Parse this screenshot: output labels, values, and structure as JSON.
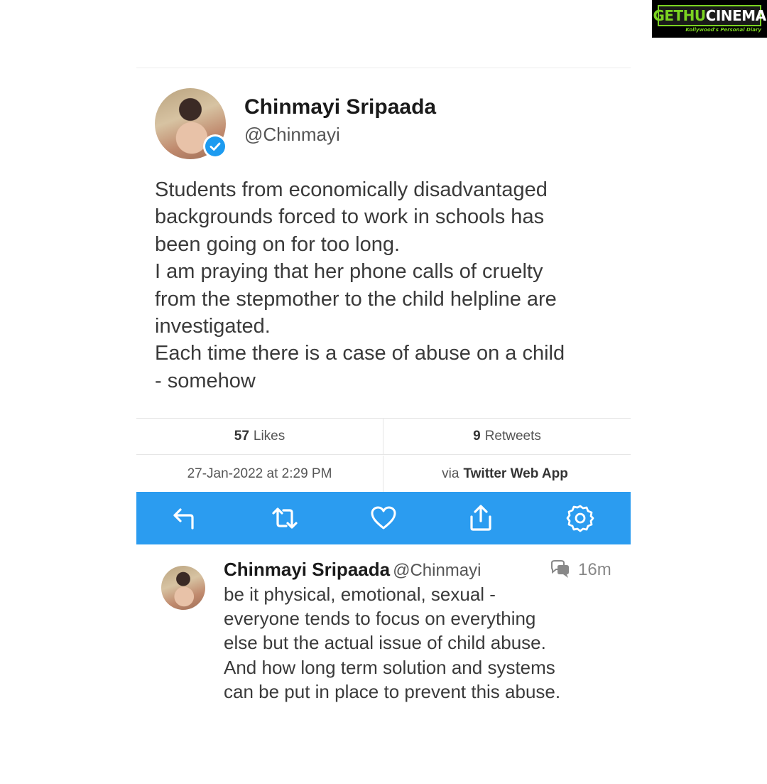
{
  "watermark": {
    "brand_a": "GETHU",
    "brand_b": "CINEMA",
    "tagline": "Kollywood's Personal Diary"
  },
  "tweet": {
    "author_name": "Chinmayi Sripaada",
    "author_handle": "@Chinmayi",
    "text_lines": [
      "Students from economically disadvantaged",
      "backgrounds forced to work in schools has",
      "been going on for too long.",
      "I am praying that her phone calls of cruelty",
      "from the stepmother to the child helpline are",
      "investigated.",
      "Each time there is a case of abuse on a child",
      "- somehow"
    ],
    "likes_count": "57",
    "likes_label": "Likes",
    "retweets_count": "9",
    "retweets_label": "Retweets",
    "timestamp": "27-Jan-2022 at 2:29 PM",
    "via_prefix": "via",
    "via_app": "Twitter Web App"
  },
  "actions": {
    "icons": [
      "reply-icon",
      "retweet-icon",
      "like-icon",
      "share-icon",
      "settings-icon"
    ],
    "bar_color": "#2b9cf0"
  },
  "reply": {
    "author_name": "Chinmayi Sripaada",
    "author_handle": "@Chinmayi",
    "time": "16m",
    "text_lines": [
      "be it physical, emotional, sexual -",
      "everyone tends to focus on everything",
      "else but the actual issue of child abuse.",
      "And how long term solution and systems",
      "can be put in place to prevent this abuse."
    ]
  }
}
